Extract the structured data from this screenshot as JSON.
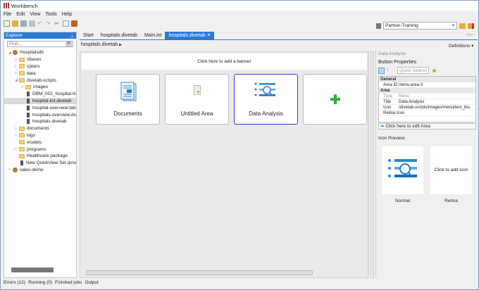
{
  "app": {
    "title": "Workbench"
  },
  "menu": [
    "File",
    "Edit",
    "View",
    "Tools",
    "Help"
  ],
  "connection": {
    "value": "Partner-Training"
  },
  "explorer": {
    "title": "Explorer",
    "find_placeholder": "Find...",
    "tree": [
      {
        "label": "Hospitalsdb",
        "type": "db",
        "level": 0,
        "expanded": true
      },
      {
        "label": "cbases",
        "type": "folder",
        "level": 1
      },
      {
        "label": "cplans",
        "type": "folder",
        "level": 1
      },
      {
        "label": "data",
        "type": "folder",
        "level": 1
      },
      {
        "label": "divetab-scripts",
        "type": "folder",
        "level": 1,
        "expanded": true
      },
      {
        "label": "images",
        "type": "folder",
        "level": 2
      },
      {
        "label": "DBM_002_hospital-list.divetab",
        "type": "file",
        "level": 2
      },
      {
        "label": "hospital-list.divetab",
        "type": "file",
        "level": 2,
        "selected": true
      },
      {
        "label": "hospital-overview-tabs.divetab",
        "type": "file",
        "level": 2
      },
      {
        "label": "hospitals-overview.divetab",
        "type": "file",
        "level": 2
      },
      {
        "label": "hospitals.divetab",
        "type": "file",
        "level": 2
      },
      {
        "label": "documents",
        "type": "folder",
        "level": 1
      },
      {
        "label": "logs",
        "type": "folder",
        "level": 1
      },
      {
        "label": "models",
        "type": "folder",
        "level": 1
      },
      {
        "label": "programs",
        "type": "folder",
        "level": 1
      },
      {
        "label": "Healthcare.package",
        "type": "package",
        "level": 1
      },
      {
        "label": "New QuickView Set.qvset",
        "type": "file",
        "level": 1
      },
      {
        "label": "sales-demo",
        "type": "db",
        "level": 0
      }
    ]
  },
  "tabs": [
    {
      "label": "Start"
    },
    {
      "label": "hospitals.divetab"
    },
    {
      "label": "Main.int"
    },
    {
      "label": "hospitals.divetab",
      "active": true
    }
  ],
  "breadcrumb": "hospitals.divetab",
  "definitions_label": "Definitions",
  "canvas": {
    "banner": "Click here to add a banner",
    "tiles": [
      {
        "label": "Documents",
        "icon": "documents-icon"
      },
      {
        "label": "Untitled Area",
        "icon": "blank-file-icon"
      },
      {
        "label": "Data Analysis",
        "icon": "data-analysis-icon",
        "selected": true
      },
      {
        "label": "",
        "icon": "plus-icon"
      }
    ]
  },
  "properties": {
    "panel_title": "Data Analysis",
    "heading": "Button Properties",
    "search_placeholder": "Quick Search",
    "general": "General",
    "area_id_label": "Area ID",
    "area_id": "menu-area-3",
    "area": "Area",
    "type_label": "Type",
    "type_value": "Menu",
    "title_label": "Title",
    "title_value": "Data Analysis",
    "icon_label": "Icon",
    "icon_value": "/divetab-scripts/images/menuItem_blu",
    "retina_label": "Retina Icon",
    "edit_area": "Click here to edit Area",
    "icon_preview": "Icon Preview:",
    "add_icon": "Click to add icon",
    "normal": "Normal",
    "retina": "Retina"
  },
  "status": [
    "Errors (12)",
    "Running (0)",
    "Finished jobs",
    "Output"
  ]
}
